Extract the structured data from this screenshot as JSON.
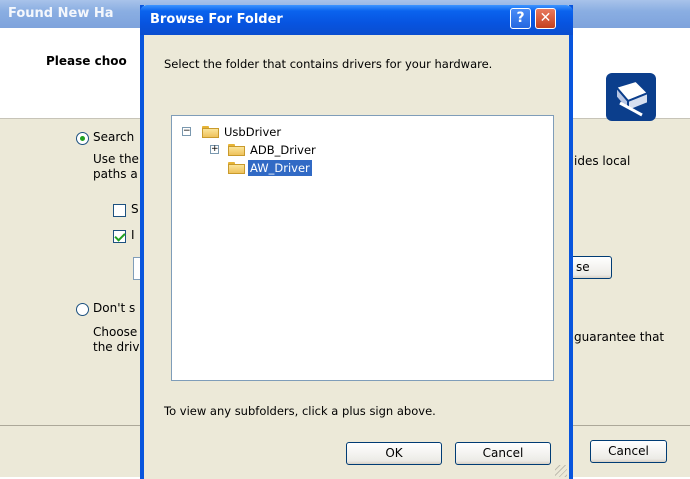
{
  "wizard": {
    "title": "Found New Ha",
    "header_title": "Please choo",
    "search_radio_label": "Search",
    "search_desc_line1_left": "Use the",
    "search_desc_line1_right": "ides local",
    "search_desc_line2_left": "paths a",
    "checkbox1_label": "S",
    "checkbox2_label": "I",
    "browse_button_visible": "se",
    "dont_search_radio_label": "Don't s",
    "choose_desc_line1_left": "Choose",
    "choose_desc_line1_right": "guarantee that",
    "choose_desc_line2_left": "the driv",
    "cancel_label": "Cancel"
  },
  "dialog": {
    "title": "Browse For Folder",
    "help_glyph": "?",
    "close_glyph": "✕",
    "instruction": "Select the folder that contains drivers for your hardware.",
    "tree": [
      {
        "label": "UsbDriver",
        "expander": "−"
      },
      {
        "label": "ADB_Driver",
        "expander": "+"
      },
      {
        "label": "AW_Driver",
        "expander": ""
      }
    ],
    "hint": "To view any subfolders, click a plus sign above.",
    "ok_label": "OK",
    "cancel_label": "Cancel"
  },
  "colors": {
    "selection": "#316ac5",
    "titlebar_active": "#0754e0",
    "titlebar_inactive": "#8aaee2",
    "dialog_face": "#ece9d8"
  },
  "state": {
    "selected_folder": "AW_Driver",
    "search_radio_checked": true,
    "checkbox1_checked": false,
    "checkbox2_checked": true
  }
}
